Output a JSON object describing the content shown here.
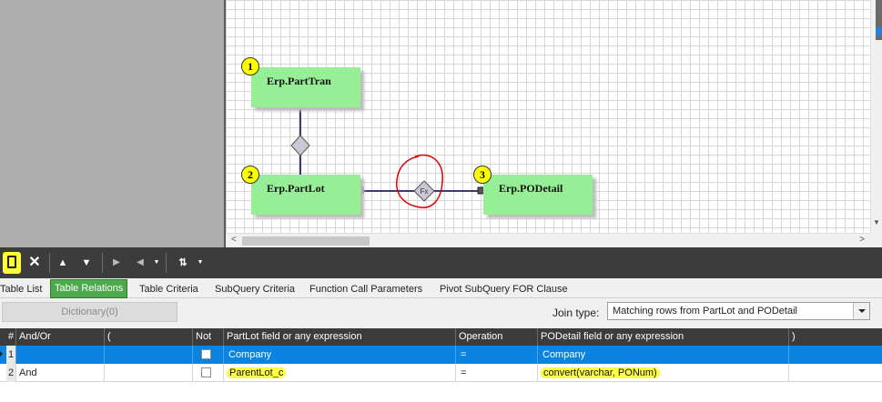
{
  "diagram": {
    "tables": [
      {
        "number": "1",
        "name": "Erp.PartTran"
      },
      {
        "number": "2",
        "name": "Erp.PartLot"
      },
      {
        "number": "3",
        "name": "Erp.PODetail"
      }
    ],
    "fx_label": "Fx"
  },
  "tabs": [
    "Table List",
    "Table Relations",
    "Table Criteria",
    "SubQuery Criteria",
    "Function Call Parameters",
    "Pivot SubQuery FOR Clause"
  ],
  "active_tab": "Table Relations",
  "dictionary_label": "Dictionary(0)",
  "join_type": {
    "label": "Join type:",
    "value": "Matching rows from PartLot and PODetail"
  },
  "grid": {
    "columns": [
      "#",
      "And/Or",
      "(",
      "Not",
      "PartLot field or any expression",
      "Operation",
      "PODetail field or any expression",
      ")"
    ],
    "rows": [
      {
        "num": "1",
        "andor": "",
        "open": "",
        "left": "Company",
        "op": "=",
        "right": "Company",
        "close": ""
      },
      {
        "num": "2",
        "andor": "And",
        "open": "",
        "left": "ParentLot_c",
        "op": "=",
        "right": "convert(varchar, PONum)",
        "close": ""
      }
    ]
  },
  "colors": {
    "table_fill": "#96ee96",
    "badge": "#ffff00",
    "selected_row": "#0a84e0",
    "active_tab": "#4caa4c",
    "annotation": "#e00000"
  }
}
